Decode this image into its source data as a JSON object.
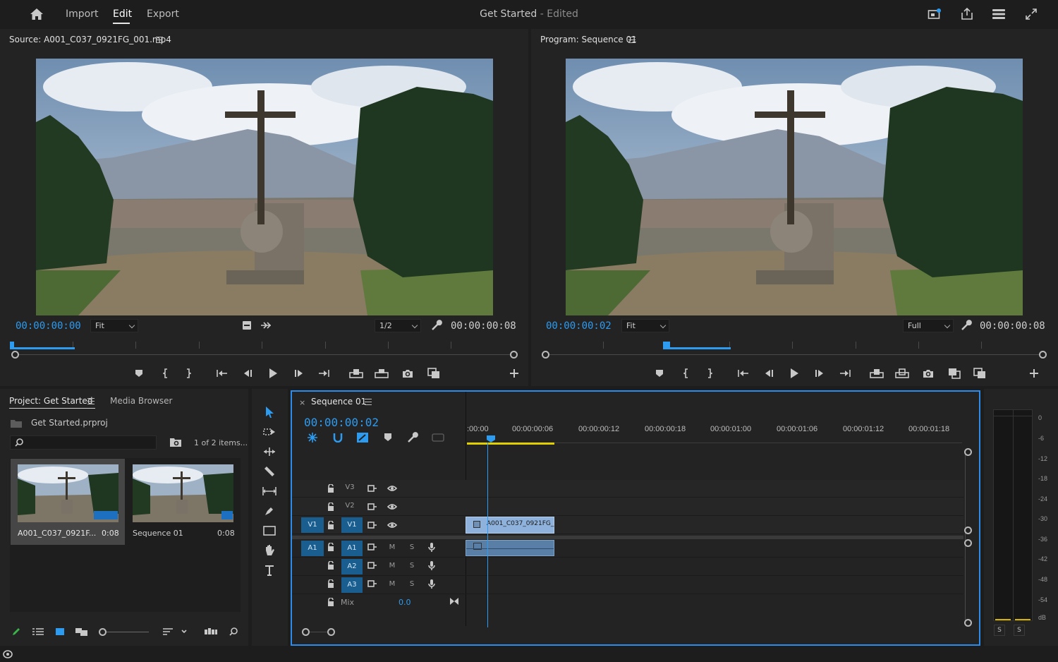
{
  "app": {
    "nav": {
      "import": "Import",
      "edit": "Edit",
      "export": "Export"
    },
    "title": {
      "name": "Get Started",
      "separator": " - ",
      "status": "Edited"
    }
  },
  "source": {
    "title": "Source: A001_C037_0921FG_001.mp4",
    "timecode_current": "00:00:00:00",
    "zoom": "Fit",
    "resolution": "1/2",
    "timecode_duration": "00:00:00:08"
  },
  "program": {
    "title": "Program: Sequence 01",
    "timecode_current": "00:00:00:02",
    "zoom": "Fit",
    "resolution": "Full",
    "timecode_duration": "00:00:00:08"
  },
  "project": {
    "tab_project": "Project: Get Started",
    "tab_media": "Media Browser",
    "file": "Get Started.prproj",
    "search_placeholder": "",
    "item_count": "1 of 2 items...",
    "items": [
      {
        "name": "A001_C037_0921F...",
        "duration": "0:08"
      },
      {
        "name": "Sequence 01",
        "duration": "0:08"
      }
    ]
  },
  "timeline": {
    "tab": "Sequence 01",
    "timecode": "00:00:00:02",
    "ruler": [
      ":00:00",
      "00:00:00:06",
      "00:00:00:12",
      "00:00:00:18",
      "00:00:01:00",
      "00:00:01:06",
      "00:00:01:12",
      "00:00:01:18"
    ],
    "video_tracks": [
      {
        "src": "",
        "name": "V3"
      },
      {
        "src": "",
        "name": "V2"
      },
      {
        "src": "V1",
        "name": "V1"
      }
    ],
    "audio_tracks": [
      {
        "src": "A1",
        "name": "A1",
        "m": "M",
        "s": "S"
      },
      {
        "src": "",
        "name": "A2",
        "m": "M",
        "s": "S"
      },
      {
        "src": "",
        "name": "A3",
        "m": "M",
        "s": "S"
      }
    ],
    "mix_label": "Mix",
    "mix_value": "0.0",
    "clip_name": "A001_C037_0921FG_"
  },
  "meter": {
    "db_labels": [
      "0",
      "-6",
      "-12",
      "-18",
      "-24",
      "-30",
      "-36",
      "-42",
      "-48",
      "-54",
      "dB"
    ],
    "solo": "S"
  },
  "colors": {
    "accent_blue": "#2d9bf0",
    "panel_border_active": "#2d8ceb",
    "track_target": "#1a5e8f",
    "clip_video": "#8eb2dc",
    "clip_audio": "#5a7fa6",
    "work_area": "#e0d000"
  }
}
